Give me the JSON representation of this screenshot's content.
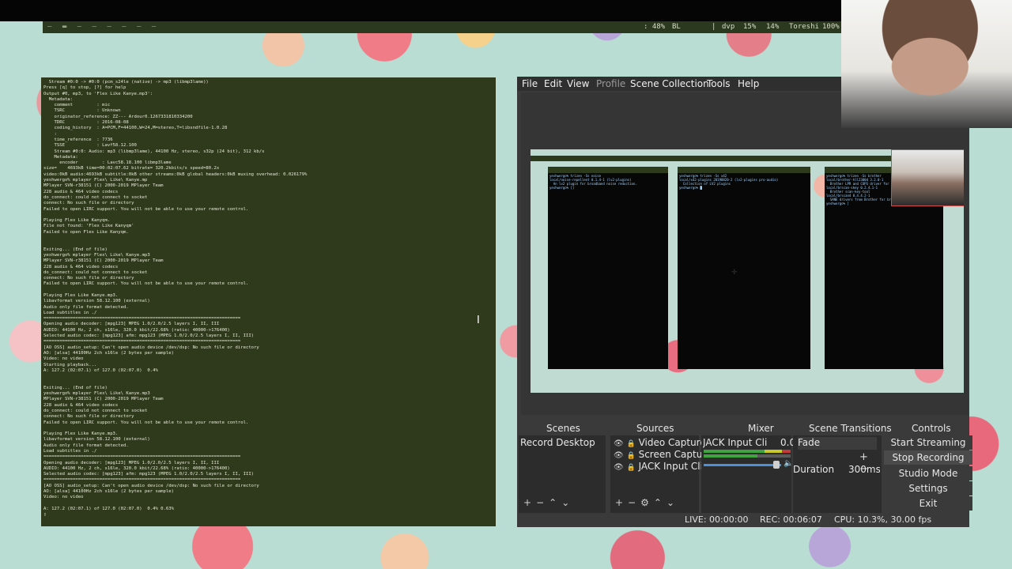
{
  "statusbar": {
    "workspaces": "– ▬ – – – – – –",
    "battery": ": 48%",
    "brightness": "BL",
    "sep": "|",
    "user": "dvp",
    "cpu": "15%",
    "mem": "14%",
    "host": "Toreshi",
    "vol": "100%"
  },
  "terminal": {
    "lines": [
      "  Stream #0:0 -> #0:0 (pcm_s24le (native) -> mp3 (libmp3lame))",
      "Press [q] to stop, [?] for help",
      "Output #0, mp3, to 'Flex Like Kanye.mp3':",
      "  Metadata:",
      "    comment         : mic",
      "    TSRC            : Unknown",
      "    originator_reference: ZZ--- Ardour0.1267331810334200",
      "    TDRC            : 2016-08-08",
      "    coding_history  : A=PCM,F=44100,W=24,M=stereo,T=libsndfile-1.0.28",
      "    :",
      "    time_reference  : 7736",
      "    TSSE            : Lavf58.12.100",
      "    Stream #0:0: Audio: mp3 (libmp3lame), 44100 Hz, stereo, s32p (24 bit), 312 kb/s",
      "    Metadata:",
      "      encoder         : Lavc58.18.100 libmp3lame",
      "size=    4693kB time=00:02:07.62 bitrate= 320.2kbits/s speed=80.2x",
      "video:0kB audio:4693kB subtitle:0kB other streams:0kB global headers:0kB muxing overhead: 0.026179%",
      "yeshwergo% mplayer Flex\\ Like\\ Kanye.mp",
      "MPlayer SVN-r38151 (C) 2000-2019 MPlayer Team",
      "228 audio & 464 video codecs",
      "do_connect: could not connect to socket",
      "connect: No such file or directory",
      "Failed to open LIRC support. You will not be able to use your remote control.",
      "",
      "Playing Flex Like Kanyqm.",
      "File not found: 'Flex Like Kanyqm'",
      "Failed to open Flex Like Kanyqm.",
      "",
      "",
      "Exiting... (End of file)",
      "yeshwergo% mplayer Flex\\ Like\\ Kanye.mp3",
      "MPlayer SVN-r38151 (C) 2000-2019 MPlayer Team",
      "228 audio & 464 video codecs",
      "do_connect: could not connect to socket",
      "connect: No such file or directory",
      "Failed to open LIRC support. You will not be able to use your remote control.",
      "",
      "Playing Flex Like Kanye.mp3.",
      "libavformat version 58.12.100 (external)",
      "Audio only file format detected.",
      "Load subtitles in ./",
      "==========================================================================",
      "Opening audio decoder: [mpg123] MPEG 1.0/2.0/2.5 layers I, II, III",
      "AUDIO: 44100 Hz, 2 ch, s16le, 320.0 kbit/22.68% (ratio: 40000->176400)",
      "Selected audio codec: [mpg123] afm: mpg123 (MPEG 1.0/2.0/2.5 layers I, II, III)",
      "==========================================================================",
      "[AO OSS] audio_setup: Can't open audio device /dev/dsp: No such file or directory",
      "AO: [alsa] 44100Hz 2ch s16le (2 bytes per sample)",
      "Video: no video",
      "Starting playback...",
      "A: 127.2 (02:07.1) of 127.0 (02:07.0)  0.4%",
      "",
      "",
      "Exiting... (End of file)",
      "yeshwergo% mplayer Flex\\ Like\\ Kanye.mp3",
      "MPlayer SVN-r38151 (C) 2000-2019 MPlayer Team",
      "228 audio & 464 video codecs",
      "do_connect: could not connect to socket",
      "connect: No such file or directory",
      "Failed to open LIRC support. You will not be able to use your remote control.",
      "",
      "Playing Flex Like Kanye.mp3.",
      "libavformat version 58.12.100 (external)",
      "Audio only file format detected.",
      "Load subtitles in ./",
      "==========================================================================",
      "Opening audio decoder: [mpg123] MPEG 1.0/2.0/2.5 layers I, II, III",
      "AUDIO: 44100 Hz, 2 ch, s16le, 320.0 kbit/22.68% (ratio: 40000->176400)",
      "Selected audio codec: [mpg123] afm: mpg123 (MPEG 1.0/2.0/2.5 layers I, II, III)",
      "==========================================================================",
      "[AO OSS] audio_setup: Can't open audio device /dev/dsp: No such file or directory",
      "AO: [alsa] 44100Hz 2ch s16le (2 bytes per sample)",
      "Video: no video",
      "",
      "A: 127.2 (02:07.1) of 127.0 (02:07.0)  0.4% 0.63%",
      "▯"
    ]
  },
  "obs": {
    "menu": [
      "File",
      "Edit",
      "View",
      "Profile",
      "Scene Collection",
      "Tools",
      "Help"
    ],
    "docks": {
      "scenes": "Scenes",
      "sources": "Sources",
      "mixer": "Mixer",
      "transitions": "Scene Transitions",
      "controls": "Controls"
    },
    "scenes": [
      "Record Desktop"
    ],
    "sources": [
      "Video Capture",
      "Screen Captur",
      "JACK Input Clie"
    ],
    "mixer": {
      "name": "JACK Input Client",
      "level": "0.0"
    },
    "transition": {
      "type": "Fade",
      "duration_label": "Duration",
      "duration_value": "300ms"
    },
    "controls": [
      "Start Streaming",
      "Stop Recording",
      "Studio Mode",
      "Settings",
      "Exit"
    ],
    "status": {
      "live": "LIVE: 00:00:00",
      "rec": "REC: 00:06:07",
      "cpu": "CPU: 10.3%, 30.00 fps"
    },
    "preview_terms": [
      "yeshwergo% trizen -Ss noise\nlocal/noise-repellent 0.1.4-1 (lv2-plugins)\n  An lv2 plugin for broadband noise reduction.\nyeshwergo% []",
      "yeshwergo% trizen -Ss x42\nlocal/x42-plugins 20190820-2 (lv2-plugins pro-audio)\n  Collection of LV2 plugins\nyeshwergo% █",
      "yeshwergo% trizen -Ss brother\nlocal/brother-hll2300d 3.2.0-1\n  Brother LPR and CUPS driver for HL-L2300D\nlocal/brscan-skey 0.2.4.1-1\n  Brother scan-key-tool\nlocal/brscan4 0.4.4.2-1\n  SANE drivers from Brother for brscan4 compatible\nyeshwergo% ]"
    ]
  }
}
